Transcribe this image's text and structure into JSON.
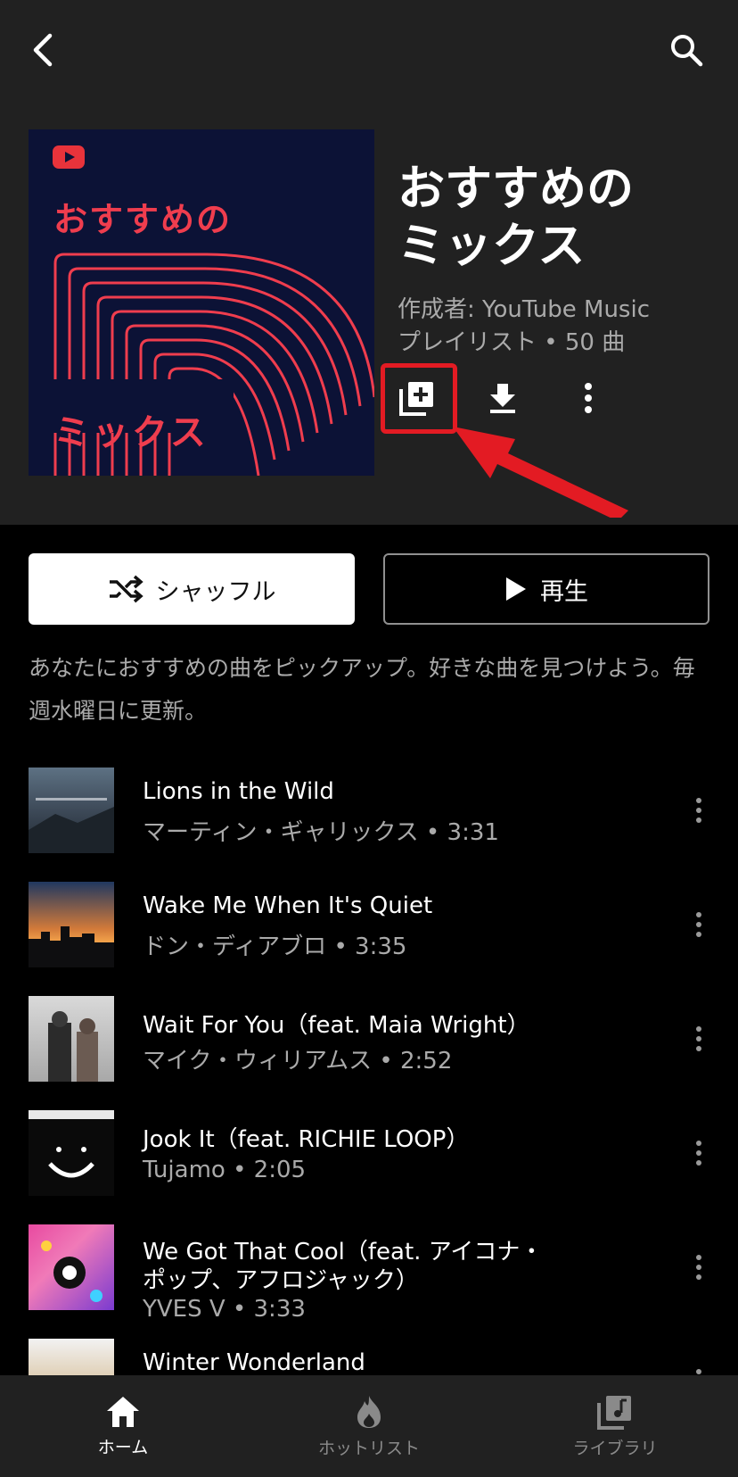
{
  "header": {
    "back_icon": "chevron-left-icon",
    "search_icon": "search-icon"
  },
  "cover": {
    "title": "おすすめの",
    "subtitle": "ミックス",
    "brand_color": "#ef3d4e"
  },
  "playlist": {
    "title_line1": "おすすめの",
    "title_line2": "ミックス",
    "author": "作成者: YouTube Music",
    "meta": "プレイリスト • 50 曲"
  },
  "actions": {
    "add_icon": "library-add-icon",
    "download_icon": "download-icon",
    "more_icon": "more-vert-icon",
    "highlight_color": "#e31b23"
  },
  "buttons": {
    "shuffle_label": "シャッフル",
    "play_label": "再生"
  },
  "description": "あなたにおすすめの曲をピックアップ。好きな曲を見つけよう。毎週水曜日に更新。",
  "tracks": [
    {
      "title": "Lions in the Wild",
      "subtitle": "マーティン・ギャリックス • 3:31"
    },
    {
      "title": "Wake Me When It's Quiet",
      "subtitle": "ドン・ディアブロ • 3:35"
    },
    {
      "title": "Wait For You（feat. Maia Wright）",
      "subtitle": "マイク・ウィリアムス • 2:52"
    },
    {
      "title": "Jook It（feat. RICHIE LOOP）",
      "subtitle": "Tujamo • 2:05"
    },
    {
      "title": "We Got That Cool（feat. アイコナ・",
      "title_line2": "ポップ、アフロジャック）",
      "subtitle": "YVES V • 3:33"
    },
    {
      "title": "Winter Wonderland",
      "subtitle": ""
    }
  ],
  "bottom_nav": [
    {
      "label": "ホーム",
      "icon": "home-icon",
      "active": true
    },
    {
      "label": "ホットリスト",
      "icon": "flame-icon",
      "active": false
    },
    {
      "label": "ライブラリ",
      "icon": "library-music-icon",
      "active": false
    }
  ]
}
